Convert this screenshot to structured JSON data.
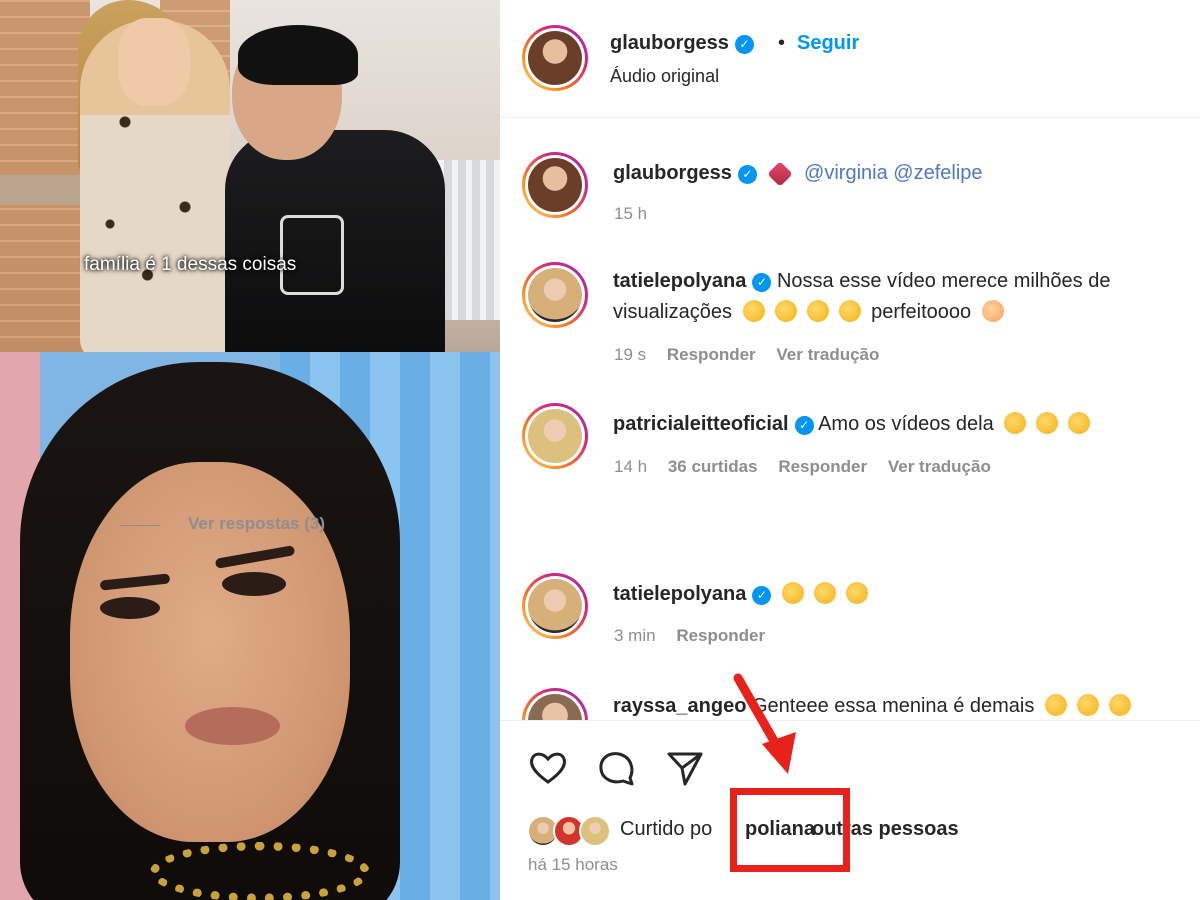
{
  "media": {
    "caption": "família é 1 dessas coisas"
  },
  "post": {
    "author": "glauborgess",
    "follow_label": "Seguir",
    "separator": "•",
    "audio": "Áudio original"
  },
  "comments": [
    {
      "user": "glauborgess",
      "verified": true,
      "mention_1": "@virginia",
      "mention_2": "@zefelipe",
      "time": "15 h"
    },
    {
      "user": "tatielepolyana",
      "verified": true,
      "text_1": "Nossa esse vídeo merece milhões de",
      "text_2": "visualizações",
      "text_3": "perfeitoooo",
      "time": "19 s",
      "reply": "Responder",
      "translate": "Ver tradução"
    },
    {
      "user": "patricialeitteoficial",
      "verified": true,
      "text": "Amo os vídeos dela",
      "time": "14 h",
      "likes": "36 curtidas",
      "reply": "Responder",
      "translate": "Ver tradução",
      "view_replies": "Ver respostas (3)"
    },
    {
      "user": "tatielepolyana",
      "verified": true,
      "time": "3 min",
      "reply": "Responder"
    },
    {
      "user": "rayssa_ange",
      "user_suffix": "o",
      "text": "Genteee essa menina é demais"
    }
  ],
  "footer": {
    "liked_prefix": "Curtido po",
    "liked_user": "poliana",
    "liked_suffix": "outras pessoas",
    "time_ago": "há 15 horas"
  },
  "colors": {
    "accent_blue": "#0095f6",
    "annotation_red": "#e8221b",
    "muted": "#8e8e8e"
  }
}
